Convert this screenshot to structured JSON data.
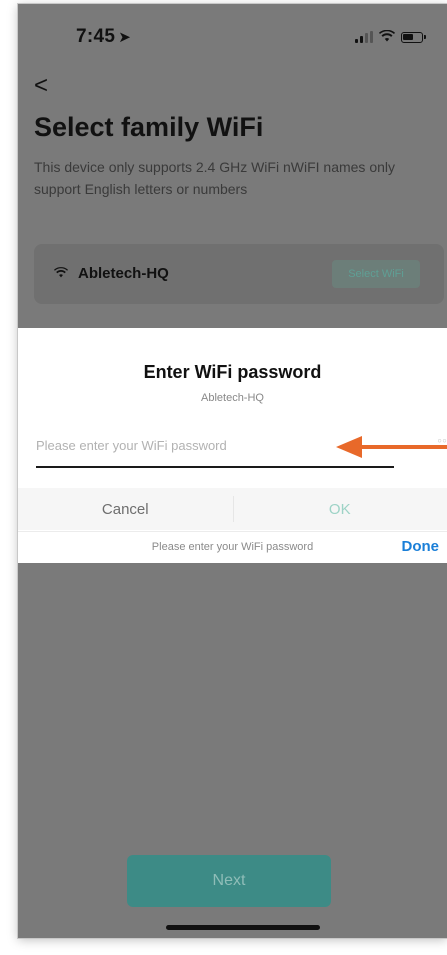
{
  "status_bar": {
    "time": "7:45"
  },
  "header": {
    "back_glyph": "<",
    "title": "Select family WiFi",
    "description": "This device only supports 2.4 GHz WiFi nWiFI names only support English letters or numbers"
  },
  "wifi_card": {
    "network_name": "Abletech-HQ",
    "select_label": "Select WiFi"
  },
  "dialog": {
    "title": "Enter WiFi password",
    "subtitle": "Abletech-HQ",
    "password_value": "",
    "password_placeholder": "Please enter your WiFi password",
    "cancel_label": "Cancel",
    "ok_label": "OK"
  },
  "keyboard_accessory": {
    "hint": "Please enter your WiFi password",
    "done_label": "Done"
  },
  "footer": {
    "next_label": "Next"
  },
  "colors": {
    "accent": "#3d8b86",
    "ok_text": "#9dd3c6",
    "done_blue": "#1a7fd8",
    "annotation_arrow": "#e8692a",
    "overlay": "#7a7a7a"
  },
  "icons": [
    "location-arrow-icon",
    "signal-icon",
    "wifi-icon",
    "battery-icon",
    "back-chevron-icon",
    "eye-icon",
    "annotation-arrow-icon"
  ]
}
